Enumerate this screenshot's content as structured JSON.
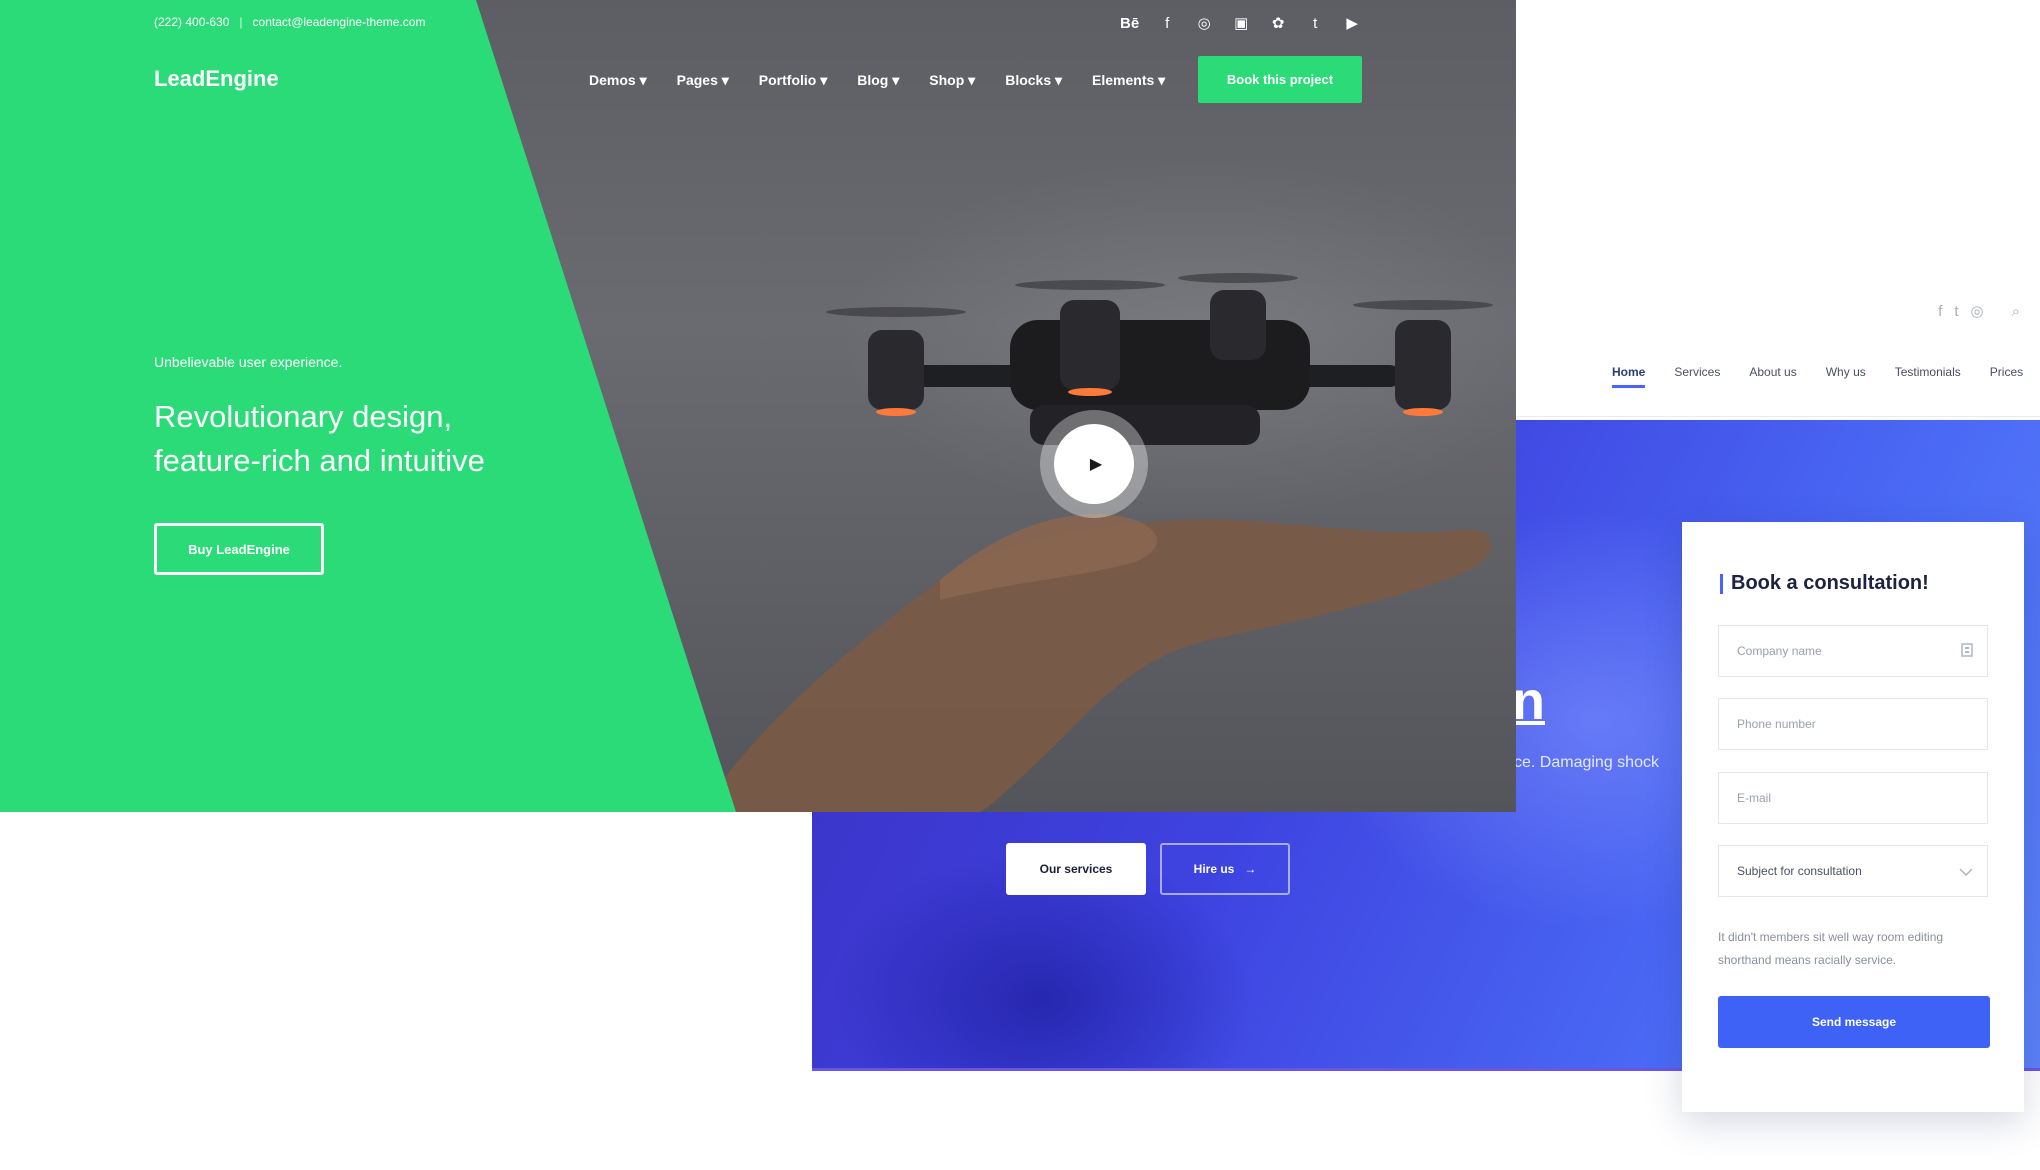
{
  "back_site": {
    "social": [
      "f",
      "t",
      "◎",
      "⌕"
    ],
    "social_icons": [
      "facebook-icon",
      "twitter-icon",
      "instagram-icon",
      "search-icon"
    ],
    "nav": [
      "Home",
      "Services",
      "About us",
      "Why us",
      "Testimonials",
      "Prices"
    ],
    "hero_fragment": "n",
    "hero_text": "ce. Damaging shock",
    "buttons": {
      "services": "Our services",
      "hire": "Hire us",
      "hire_arrow": "→"
    },
    "form": {
      "title": "Book a consultation!",
      "company_placeholder": "Company name",
      "phone_placeholder": "Phone number",
      "email_placeholder": "E-mail",
      "subject_value": "Subject for consultation",
      "note": "It didn't members sit well way room editing shorthand means racially service.",
      "send": "Send message"
    }
  },
  "front_site": {
    "phone": "(222) 400-630",
    "separator": "|",
    "email": "contact@leadengine-theme.com",
    "logo": "LeadEngine",
    "social": [
      "Bē",
      "f",
      "◎",
      "▣",
      "✿",
      "t",
      "▶"
    ],
    "social_icons": [
      "behance-icon",
      "facebook-icon",
      "instagram-icon",
      "linkedin-icon",
      "dribbble-icon",
      "twitter-icon",
      "youtube-icon"
    ],
    "nav": [
      "Demos ▾",
      "Pages ▾",
      "Portfolio ▾",
      "Blog ▾",
      "Shop ▾",
      "Blocks ▾",
      "Elements ▾"
    ],
    "cta": "Book this project",
    "tagline": "Unbelievable user experience.",
    "headline_line1": "Revolutionary design,",
    "headline_line2": "feature-rich and intuitive",
    "buy": "Buy LeadEngine",
    "play_icon": "▶"
  },
  "colors": {
    "green": "#2bdb77",
    "blue": "#3d62f5",
    "dark_overlay": "#5d5e63"
  }
}
